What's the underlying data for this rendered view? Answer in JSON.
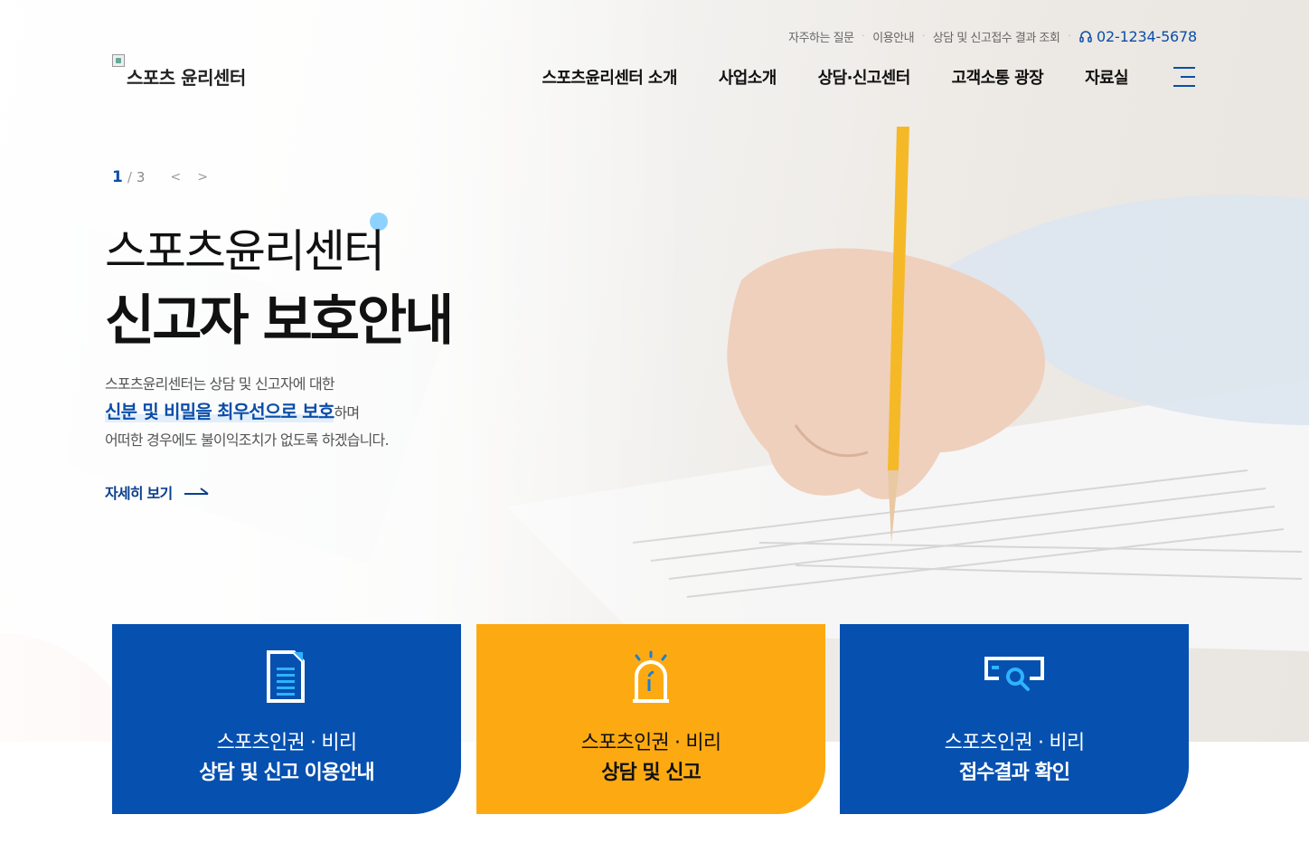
{
  "colors": {
    "brand_blue": "#0b4ea8",
    "card_blue": "#0650b0",
    "card_yellow": "#fdaa12",
    "accent_dot": "#8dd2ff"
  },
  "util": {
    "links": [
      "자주하는 질문",
      "이용안내",
      "상담 및 신고접수 결과 조회"
    ],
    "phone": "02-1234-5678"
  },
  "logo": {
    "alt": "스포츠 윤리센터"
  },
  "nav": {
    "items": [
      "스포츠윤리센터 소개",
      "사업소개",
      "상담·신고센터",
      "고객소통 광장",
      "자료실"
    ],
    "menu_icon": "hamburger-icon"
  },
  "slider": {
    "current": "1",
    "total": "3",
    "prev_icon": "chevron-left-icon",
    "next_icon": "chevron-right-icon"
  },
  "hero": {
    "subtitle": "스포츠윤리센터",
    "title": "신고자 보호안내",
    "desc_line1": "스포츠윤리센터는 상담 및 신고자에 대한",
    "desc_highlight": "신분 및 비밀을 최우선으로 보호",
    "desc_line2_suffix": "하며",
    "desc_line3": "어떠한 경우에도 불이익조치가 없도록 하겠습니다.",
    "more_label": "자세히 보기"
  },
  "cards": [
    {
      "icon": "document-icon",
      "line1": "스포츠인권 · 비리",
      "line2": "상담 및 신고 이용안내"
    },
    {
      "icon": "siren-icon",
      "line1": "스포츠인권 · 비리",
      "line2": "상담 및 신고"
    },
    {
      "icon": "search-screen-icon",
      "line1": "스포츠인권 · 비리",
      "line2": "접수결과 확인"
    }
  ]
}
